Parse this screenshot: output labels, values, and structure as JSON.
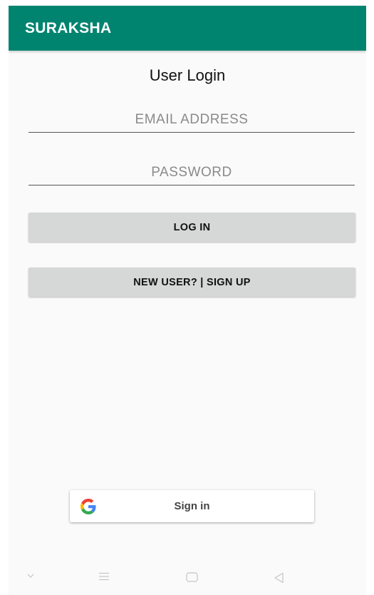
{
  "app": {
    "title": "SURAKSHA",
    "theme_color": "#00846f"
  },
  "login": {
    "heading": "User Login",
    "email_placeholder": "EMAIL ADDRESS",
    "email_value": "",
    "password_placeholder": "PASSWORD",
    "password_value": "",
    "login_button": "LOG IN",
    "signup_button": "NEW USER? | SIGN UP"
  },
  "google_signin": {
    "icon": "google-g-icon",
    "label": "Sign in"
  },
  "nav_bar": {
    "icons": [
      "chevron-down-icon",
      "menu-icon",
      "home-icon",
      "back-icon"
    ]
  }
}
